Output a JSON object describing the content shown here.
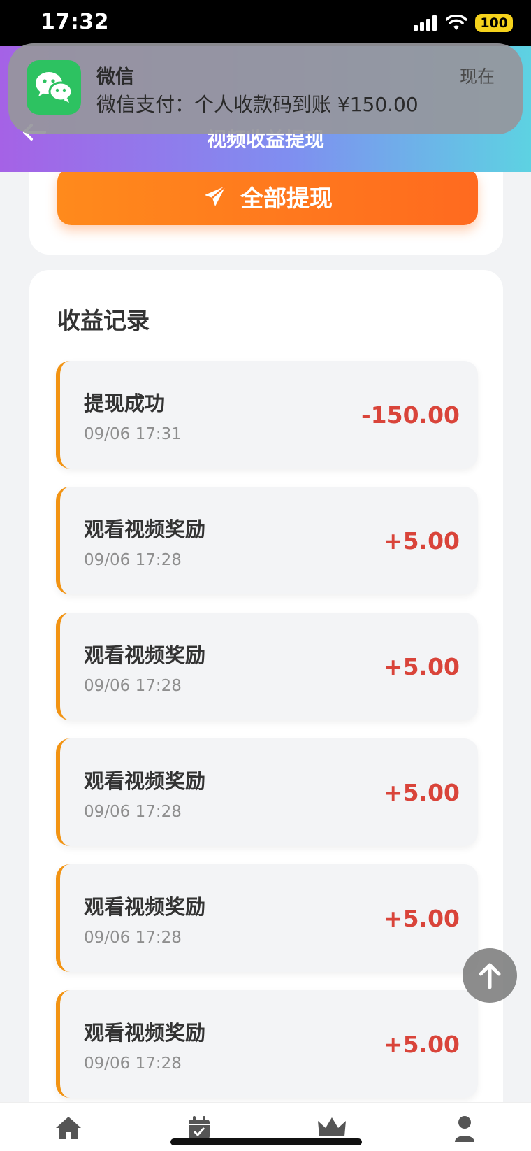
{
  "status_bar": {
    "time": "17:32",
    "battery": "100"
  },
  "notification": {
    "app_name": "微信",
    "message": "微信支付：个人收款码到账 ¥150.00",
    "time": "现在"
  },
  "header": {
    "title": "视频收益提现"
  },
  "withdraw": {
    "button_label": "全部提现"
  },
  "records": {
    "title": "收益记录",
    "items": [
      {
        "name": "提现成功",
        "time": "09/06 17:31",
        "amount": "-150.00"
      },
      {
        "name": "观看视频奖励",
        "time": "09/06 17:28",
        "amount": "+5.00"
      },
      {
        "name": "观看视频奖励",
        "time": "09/06 17:28",
        "amount": "+5.00"
      },
      {
        "name": "观看视频奖励",
        "time": "09/06 17:28",
        "amount": "+5.00"
      },
      {
        "name": "观看视频奖励",
        "time": "09/06 17:28",
        "amount": "+5.00"
      },
      {
        "name": "观看视频奖励",
        "time": "09/06 17:28",
        "amount": "+5.00"
      }
    ]
  },
  "colors": {
    "accent_orange": "#ff7a1e",
    "amount_red": "#d9443a",
    "record_border": "#f29312"
  },
  "bottom_nav": {
    "items": [
      {
        "icon": "home-icon"
      },
      {
        "icon": "calendar-check-icon"
      },
      {
        "icon": "crown-icon"
      },
      {
        "icon": "user-icon"
      }
    ]
  }
}
